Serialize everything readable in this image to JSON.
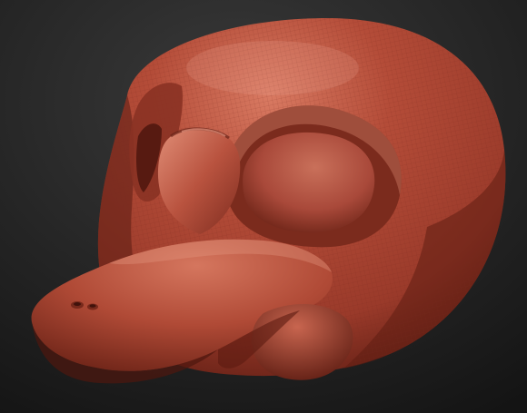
{
  "viewport": {
    "background_top": "#3a3a3a",
    "background_bottom": "#141414"
  },
  "model": {
    "subject": "platypus-head-sculpt",
    "material_light": "#d97a62",
    "material_base": "#b44c38",
    "material_mid": "#9a3a2a",
    "material_dark": "#5e1d13",
    "material_shadow": "#3b100a",
    "wireframe_color": "#7a2a1e"
  }
}
